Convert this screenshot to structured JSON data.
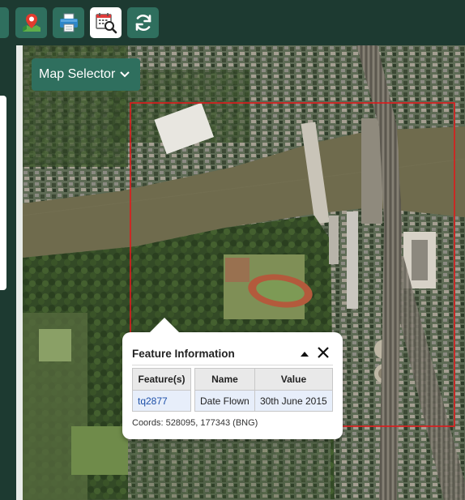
{
  "toolbar": {
    "buttons": [
      {
        "icon": "map-marker-icon",
        "active": false
      },
      {
        "icon": "printer-icon",
        "active": false
      },
      {
        "icon": "calendar-search-icon",
        "active": true
      },
      {
        "icon": "refresh-icon",
        "active": false
      }
    ]
  },
  "map_selector": {
    "label": "Map Selector"
  },
  "popup": {
    "title": "Feature Information",
    "features_table": {
      "header": "Feature(s)",
      "rows": [
        "tq2877"
      ]
    },
    "attributes_table": {
      "headers": [
        "Name",
        "Value"
      ],
      "rows": [
        [
          "Date Flown",
          "30th June 2015"
        ]
      ]
    },
    "coords": "Coords: 528095, 177343 (BNG)"
  },
  "colors": {
    "toolbar_bg": "#1d3a31",
    "accent": "#2f6f5e",
    "selection_box": "#e0191b"
  }
}
